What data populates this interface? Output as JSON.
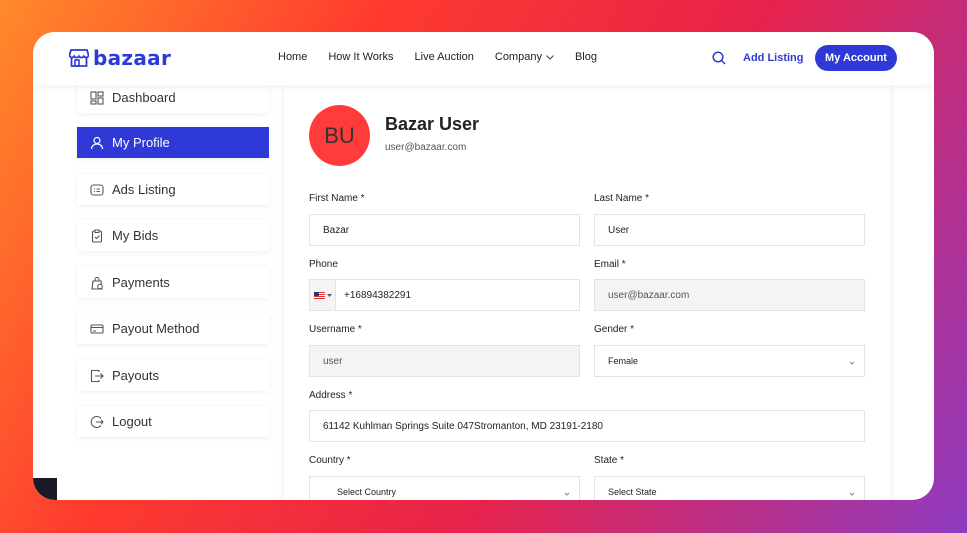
{
  "brand": {
    "name": "bazaar",
    "color": "#2f3ad6"
  },
  "nav": {
    "items": [
      "Home",
      "How It Works",
      "Live Auction",
      "Company",
      "Blog"
    ],
    "add_listing": "Add Listing",
    "my_account": "My Account"
  },
  "sidebar": {
    "items": [
      {
        "label": "Dashboard",
        "icon": "dashboard-icon"
      },
      {
        "label": "My Profile",
        "icon": "user-icon",
        "active": true
      },
      {
        "label": "Ads Listing",
        "icon": "ads-icon"
      },
      {
        "label": "My Bids",
        "icon": "bids-icon"
      },
      {
        "label": "Payments",
        "icon": "payments-icon"
      },
      {
        "label": "Payout Method",
        "icon": "payout-method-icon"
      },
      {
        "label": "Payouts",
        "icon": "payouts-icon"
      },
      {
        "label": "Logout",
        "icon": "logout-icon"
      }
    ]
  },
  "profile": {
    "initials": "BU",
    "name": "Bazar User",
    "email": "user@bazaar.com"
  },
  "form": {
    "first_name": {
      "label": "First Name *",
      "value": "Bazar"
    },
    "last_name": {
      "label": "Last Name *",
      "value": "User"
    },
    "phone": {
      "label": "Phone",
      "value": "+16894382291"
    },
    "email": {
      "label": "Email *",
      "value": "user@bazaar.com"
    },
    "username": {
      "label": "Username *",
      "value": "user"
    },
    "gender": {
      "label": "Gender *",
      "value": "Female"
    },
    "address": {
      "label": "Address *",
      "value": "61142 Kuhlman Springs Suite 047Stromanton, MD 23191-2180"
    },
    "country": {
      "label": "Country *",
      "value": "Select Country"
    },
    "state": {
      "label": "State *",
      "value": "Select State"
    }
  },
  "colors": {
    "accent": "#2f3ad6",
    "avatar": "#ff3b3b"
  }
}
